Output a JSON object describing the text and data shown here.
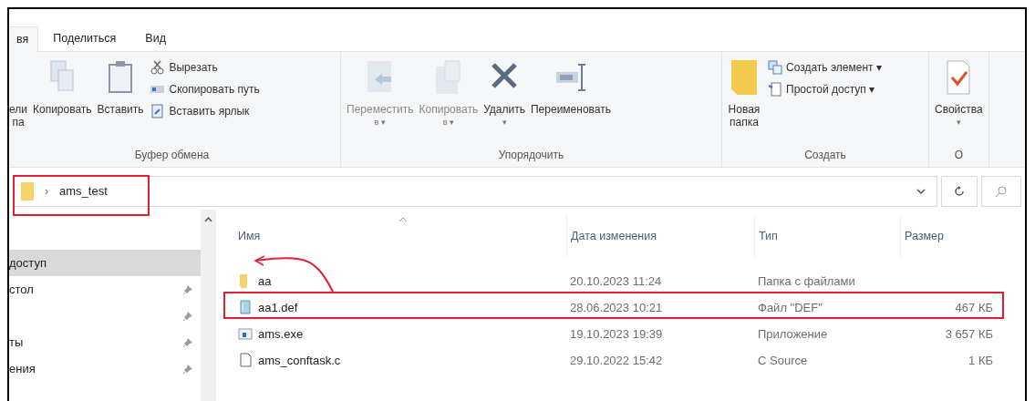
{
  "ribbon_tabs": [
    {
      "label": "вя",
      "selected": true
    },
    {
      "label": "Поделиться",
      "selected": false
    },
    {
      "label": "Вид",
      "selected": false
    }
  ],
  "ribbon_groups": [
    {
      "label": "Буфер обмена",
      "large": [
        {
          "label": "ели\nпа",
          "kind": "pin"
        },
        {
          "label": "Копировать",
          "kind": "copy"
        },
        {
          "label": "Вставить",
          "kind": "paste"
        }
      ],
      "small": [
        {
          "label": "Вырезать",
          "kind": "cut"
        },
        {
          "label": "Скопировать путь",
          "kind": "path"
        },
        {
          "label": "Вставить ярлык",
          "kind": "shortcut"
        }
      ]
    },
    {
      "label": "Упорядочить",
      "large": [
        {
          "label": "Переместить",
          "sub": "в ▾",
          "kind": "move",
          "disabled": true
        },
        {
          "label": "Копировать",
          "sub": "в ▾",
          "kind": "copyto",
          "disabled": true
        },
        {
          "label": "Удалить",
          "sub": "▾",
          "kind": "delete",
          "disabled": false
        },
        {
          "label": "Переименовать",
          "kind": "rename",
          "disabled": false
        }
      ]
    },
    {
      "label": "Создать",
      "large": [
        {
          "label": "Новая\nпапка",
          "kind": "folder"
        }
      ],
      "small": [
        {
          "label": "Создать элемент ▾",
          "kind": "new"
        },
        {
          "label": "Простой доступ ▾",
          "kind": "access"
        }
      ]
    },
    {
      "label": "О",
      "large": [
        {
          "label": "Свойства",
          "sub": "▾",
          "kind": "props"
        }
      ]
    }
  ],
  "address_bar": {
    "separator": "›",
    "path": "ams_test"
  },
  "nav_pane": [
    {
      "label": "доступ",
      "selected": true,
      "pinned": false
    },
    {
      "label": "стол",
      "selected": false,
      "pinned": true
    },
    {
      "selected": false,
      "pinned": true
    },
    {
      "label": "ты",
      "selected": false,
      "pinned": true
    },
    {
      "label": "ения",
      "selected": false,
      "pinned": true
    }
  ],
  "file_list": {
    "columns": [
      "Имя",
      "Дата изменения",
      "Тип",
      "Размер"
    ],
    "rows": [
      {
        "name": "aa",
        "kind": "folder",
        "date": "20.10.2023 11:24",
        "type": "Папка с файлами"
      },
      {
        "name": "aa1.def",
        "kind": "def",
        "date": "28.06.2023 10:21",
        "type": "Файл \"DEF\"",
        "size": "467 КБ"
      },
      {
        "name": "ams.exe",
        "kind": "exe",
        "date": "19.10.2023 19:39",
        "type": "Приложение",
        "size": "3 657 КБ"
      },
      {
        "name": "ams_conftask.c",
        "kind": "c",
        "date": "29.10.2022 15:42",
        "type": "C Source",
        "size": "1 КБ"
      }
    ]
  }
}
